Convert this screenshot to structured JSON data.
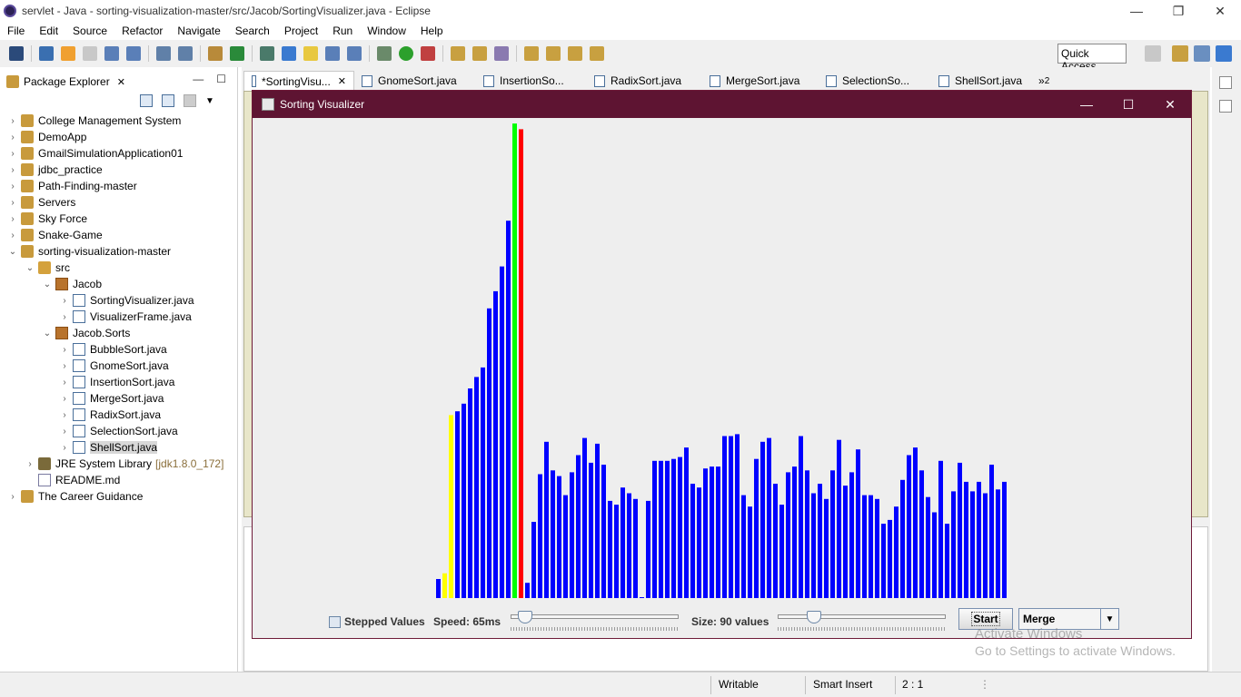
{
  "window": {
    "title": "servlet - Java - sorting-visualization-master/src/Jacob/SortingVisualizer.java - Eclipse"
  },
  "menu": [
    "File",
    "Edit",
    "Source",
    "Refactor",
    "Navigate",
    "Search",
    "Project",
    "Run",
    "Window",
    "Help"
  ],
  "toolbar": {
    "quick_access": "Quick Access"
  },
  "package_explorer": {
    "title": "Package Explorer",
    "items": [
      {
        "label": "College Management System",
        "level": 0,
        "expanded": false,
        "type": "proj"
      },
      {
        "label": "DemoApp",
        "level": 0,
        "expanded": false,
        "type": "proj"
      },
      {
        "label": "GmailSimulationApplication01",
        "level": 0,
        "expanded": false,
        "type": "proj"
      },
      {
        "label": "jdbc_practice",
        "level": 0,
        "expanded": false,
        "type": "proj"
      },
      {
        "label": "Path-Finding-master",
        "level": 0,
        "expanded": false,
        "type": "proj"
      },
      {
        "label": "Servers",
        "level": 0,
        "expanded": false,
        "type": "proj"
      },
      {
        "label": "Sky Force",
        "level": 0,
        "expanded": false,
        "type": "proj"
      },
      {
        "label": "Snake-Game",
        "level": 0,
        "expanded": false,
        "type": "proj"
      },
      {
        "label": "sorting-visualization-master",
        "level": 0,
        "expanded": true,
        "type": "proj"
      },
      {
        "label": "src",
        "level": 1,
        "expanded": true,
        "type": "src"
      },
      {
        "label": "Jacob",
        "level": 2,
        "expanded": true,
        "type": "pkg"
      },
      {
        "label": "SortingVisualizer.java",
        "level": 3,
        "expanded": false,
        "type": "java"
      },
      {
        "label": "VisualizerFrame.java",
        "level": 3,
        "expanded": false,
        "type": "java"
      },
      {
        "label": "Jacob.Sorts",
        "level": 2,
        "expanded": true,
        "type": "pkg"
      },
      {
        "label": "BubbleSort.java",
        "level": 3,
        "expanded": false,
        "type": "java"
      },
      {
        "label": "GnomeSort.java",
        "level": 3,
        "expanded": false,
        "type": "java"
      },
      {
        "label": "InsertionSort.java",
        "level": 3,
        "expanded": false,
        "type": "java"
      },
      {
        "label": "MergeSort.java",
        "level": 3,
        "expanded": false,
        "type": "java"
      },
      {
        "label": "RadixSort.java",
        "level": 3,
        "expanded": false,
        "type": "java"
      },
      {
        "label": "SelectionSort.java",
        "level": 3,
        "expanded": false,
        "type": "java"
      },
      {
        "label": "ShellSort.java",
        "level": 3,
        "expanded": false,
        "type": "java",
        "selected": true
      },
      {
        "label": "JRE System Library",
        "suffix": "[jdk1.8.0_172]",
        "level": 1,
        "expanded": false,
        "type": "lib"
      },
      {
        "label": "README.md",
        "level": 1,
        "leaf": true,
        "type": "md"
      },
      {
        "label": "The Career Guidance",
        "level": 0,
        "expanded": false,
        "type": "proj"
      }
    ]
  },
  "editor_tabs": [
    {
      "label": "*SortingVisu...",
      "active": true
    },
    {
      "label": "GnomeSort.java"
    },
    {
      "label": "InsertionSo..."
    },
    {
      "label": "RadixSort.java"
    },
    {
      "label": "MergeSort.java"
    },
    {
      "label": "SelectionSo..."
    },
    {
      "label": "ShellSort.java"
    }
  ],
  "more_tabs": "2",
  "visualizer": {
    "title": "Sorting Visualizer",
    "stepped_label": "Stepped Values",
    "speed_label": "Speed: 65ms",
    "size_label": "Size: 90 values",
    "start_label": "Start",
    "algorithm": "Merge",
    "speed_fraction": 0.06,
    "size_fraction": 0.19
  },
  "chart_data": {
    "type": "bar",
    "colors": {
      "default": "#0000ff",
      "compare": "#ffff00",
      "current": "#00ff00",
      "swap": "#ff0000"
    },
    "values": [
      10,
      13,
      96,
      98,
      102,
      110,
      116,
      121,
      152,
      161,
      174,
      198,
      249,
      246,
      8,
      40,
      65,
      82,
      67,
      64,
      54,
      66,
      75,
      84,
      71,
      81,
      70,
      51,
      49,
      58,
      55,
      52,
      0,
      51,
      72,
      72,
      72,
      73,
      74,
      79,
      60,
      58,
      68,
      69,
      69,
      85,
      85,
      86,
      54,
      48,
      73,
      82,
      84,
      60,
      49,
      66,
      69,
      85,
      67,
      55,
      60,
      52,
      67,
      83,
      59,
      66,
      78,
      54,
      54,
      52,
      39,
      41,
      48,
      62,
      75,
      79,
      67,
      53,
      45,
      72,
      39,
      56,
      71,
      61,
      56,
      61,
      55,
      70,
      57,
      61
    ],
    "highlights": {
      "1": "compare",
      "2": "compare",
      "12": "current",
      "13": "swap"
    }
  },
  "status": {
    "writable": "Writable",
    "insert": "Smart Insert",
    "position": "2 : 1"
  },
  "watermark": {
    "line1": "Activate Windows",
    "line2": "Go to Settings to activate Windows."
  }
}
